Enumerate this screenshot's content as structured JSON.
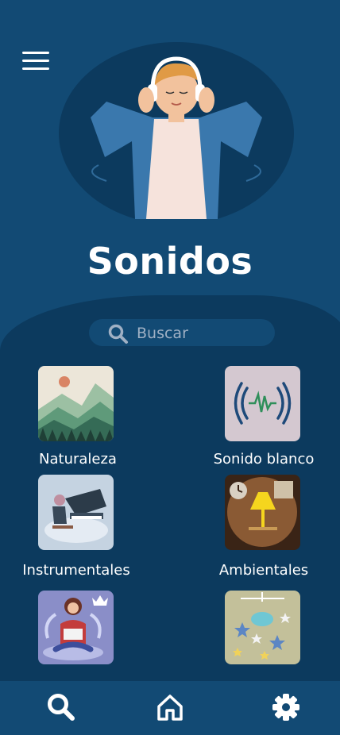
{
  "header": {
    "title": "Sonidos"
  },
  "search": {
    "placeholder": "Buscar"
  },
  "categories": [
    {
      "label": "Naturaleza"
    },
    {
      "label": "Sonido blanco"
    },
    {
      "label": "Instrumentales"
    },
    {
      "label": "Ambientales"
    },
    {
      "label": ""
    },
    {
      "label": ""
    }
  ],
  "colors": {
    "background": "#124a74",
    "panel": "#0c3a5e",
    "search_bg": "#124a74",
    "text": "#ffffff",
    "placeholder": "#9fb0c4"
  },
  "icons": {
    "menu": "hamburger-icon",
    "search": "magnifier-icon",
    "home": "home-icon",
    "settings": "gear-icon",
    "premium": "crown-icon"
  }
}
